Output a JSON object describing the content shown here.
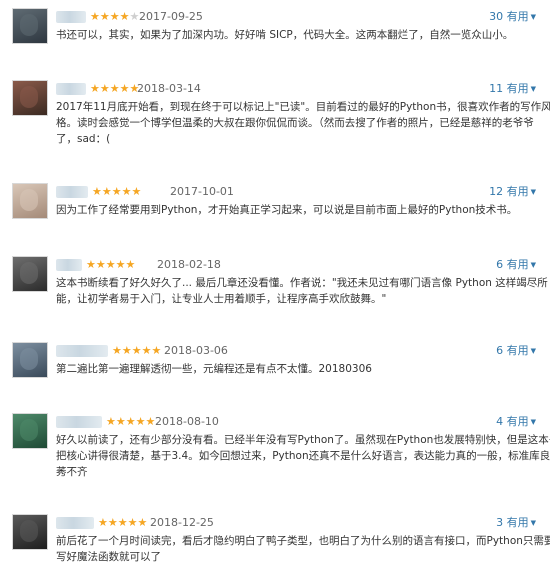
{
  "reviews": [
    {
      "stars": 4,
      "date": "2017-09-25",
      "votes": "30 有用",
      "avatar_colors": [
        "#5f6b73",
        "#2e3740"
      ],
      "name_width": 28,
      "lines": [
        "书还可以，其实，如果为了加深内功。好好啃 SICP，代码大全。这两本翻烂了，自然一览众山小。"
      ]
    },
    {
      "stars": 5,
      "date": "2018-03-14",
      "votes": "11 有用",
      "avatar_colors": [
        "#8a5a4a",
        "#3b2a22"
      ],
      "name_width": 30,
      "lines": [
        "2017年11月底开始看，到现在终于可以标记上\"已读\"。目前看过的最好的Python书，很喜欢作者的写作风",
        "格。读时会感觉一个博学但温柔的大叔在跟你侃侃而谈。（然而去搜了作者的照片，已经是慈祥的老爷爷",
        "了，sad：("
      ]
    },
    {
      "stars": 5,
      "date": "2017-10-01",
      "votes": "12 有用",
      "avatar_colors": [
        "#d9c7b8",
        "#a48a78"
      ],
      "name_width": 36,
      "lines": [
        "因为工作了经常要用到Python，才开始真正学习起来，可以说是目前市面上最好的Python技术书。"
      ]
    },
    {
      "stars": 5,
      "date": "2018-02-18",
      "votes": "6 有用",
      "avatar_colors": [
        "#6e6e6e",
        "#2b2b2b"
      ],
      "name_width": 24,
      "lines": [
        "这本书断续看了好久好久了... 最后几章还没看懂。作者说：\"我还未见过有哪门语言像 Python 这样竭尽所",
        "能，让初学者易于入门，让专业人士用着顺手，让程序高手欢欣鼓舞。\""
      ]
    },
    {
      "stars": 5,
      "date": "2018-03-06",
      "votes": "6 有用",
      "avatar_colors": [
        "#7d8fa0",
        "#3a4a5a"
      ],
      "name_width": 50,
      "lines": [
        "第二遍比第一遍理解透彻一些，元编程还是有点不太懂。20180306"
      ]
    },
    {
      "stars": 5,
      "date": "2018-08-10",
      "votes": "4 有用",
      "avatar_colors": [
        "#4e8a6a",
        "#1f4a35"
      ],
      "name_width": 48,
      "lines": [
        "好久以前读了，还有少部分没有看。已经半年没有写Python了。虽然现在Python也发展特别快，但是这本书",
        "把核心讲得很清楚，基于3.4。如今回想过来，Python还真不是什么好语言，表达能力真的一般，标准库良",
        "莠不齐"
      ]
    },
    {
      "stars": 5,
      "date": "2018-12-25",
      "votes": "3 有用",
      "avatar_colors": [
        "#5a5a5a",
        "#1e1e1e"
      ],
      "name_width": 42,
      "lines": [
        "前后花了一个月时间读完，看后才隐约明白了鸭子类型，也明白了为什么别的语言有接口，而Python只需要",
        "写好魔法函数就可以了"
      ]
    }
  ]
}
